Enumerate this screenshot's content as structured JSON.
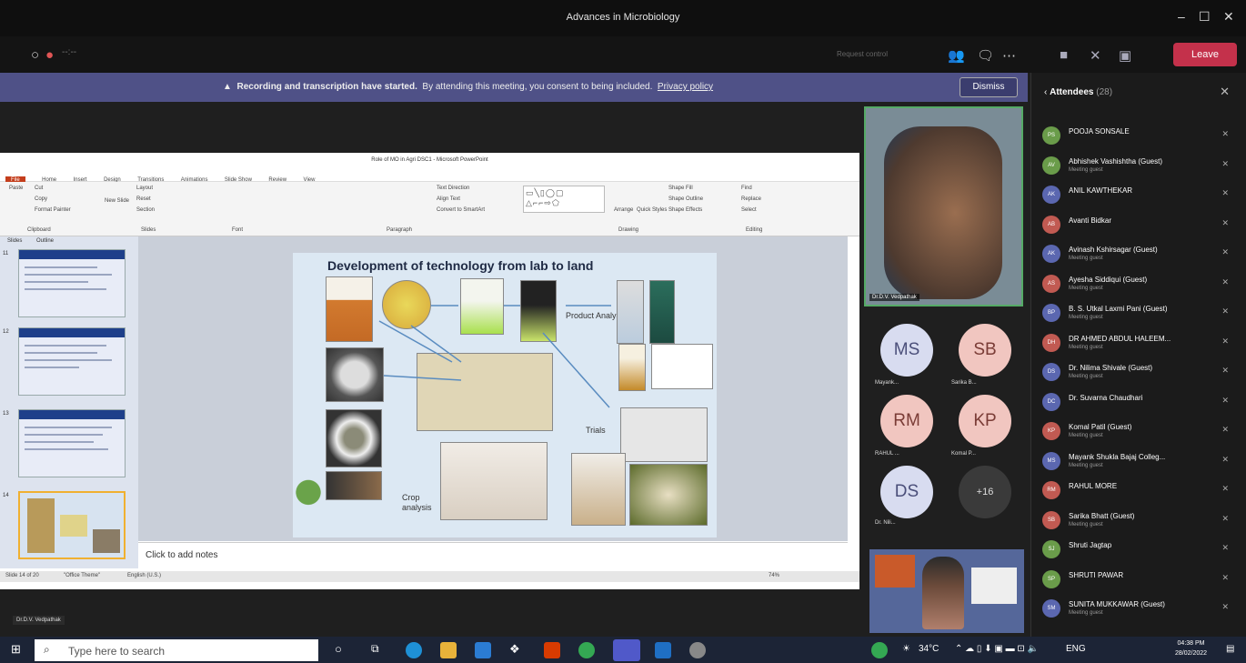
{
  "window": {
    "title": "Advances in Microbiology"
  },
  "toolbar": {
    "request_control": "Request control",
    "leave_label": "Leave"
  },
  "banner": {
    "bold": "Recording and transcription have started.",
    "text": "By attending this meeting, you consent to being included.",
    "link": "Privacy policy",
    "dismiss": "Dismiss"
  },
  "powerpoint": {
    "title": "Role of MO in Agri DSC1 - Microsoft PowerPoint",
    "tabs": [
      "File",
      "Home",
      "Insert",
      "Design",
      "Transitions",
      "Animations",
      "Slide Show",
      "Review",
      "View"
    ],
    "ribbon": {
      "cut": "Cut",
      "copy": "Copy",
      "format_painter": "Format Painter",
      "paste": "Paste",
      "new_slide": "New Slide",
      "layout": "Layout",
      "reset": "Reset",
      "section": "Section",
      "clipboard": "Clipboard",
      "slides": "Slides",
      "font": "Font",
      "paragraph": "Paragraph",
      "drawing": "Drawing",
      "editing": "Editing",
      "find": "Find",
      "replace": "Replace",
      "select": "Select",
      "text_direction": "Text Direction",
      "align_text": "Align Text",
      "smartart": "Convert to SmartArt",
      "arrange": "Arrange",
      "quick_styles": "Quick Styles",
      "shape_fill": "Shape Fill",
      "shape_outline": "Shape Outline",
      "shape_effects": "Shape Effects"
    },
    "pane_tabs": [
      "Slides",
      "Outline"
    ],
    "thumb_numbers": [
      "11",
      "12",
      "13",
      "14"
    ],
    "slide": {
      "title": "Development of technology from lab to land",
      "labels": {
        "product": "Product Analysis",
        "trials": "Trials",
        "crop": "Crop analysis"
      }
    },
    "notes_placeholder": "Click to add notes",
    "status": {
      "slide": "Slide 14 of 20",
      "theme": "\"Office Theme\"",
      "language": "English (U.S.)",
      "zoom": "74%"
    }
  },
  "presenter_label": "Dr.D.V. Vedpathak",
  "main_video": {
    "name": "Dr.D.V. Vedpathak"
  },
  "gallery": [
    {
      "initials": "MS",
      "name": "Mayank...",
      "bg": "#d8dcf0",
      "fg": "#4b4f7a"
    },
    {
      "initials": "SB",
      "name": "Sarika B...",
      "bg": "#f1c6c0",
      "fg": "#7a3c36"
    },
    {
      "initials": "RM",
      "name": "RAHUL ...",
      "bg": "#f1c6c0",
      "fg": "#7a3c36"
    },
    {
      "initials": "KP",
      "name": "Komal P...",
      "bg": "#f1c6c0",
      "fg": "#7a3c36"
    },
    {
      "initials": "DS",
      "name": "Dr. Nili...",
      "bg": "#d8dcf0",
      "fg": "#4b4f7a"
    },
    {
      "initials": "+16",
      "name": "",
      "bg": "#3a3a3a",
      "fg": "#ddd"
    }
  ],
  "attendees": {
    "title": "Attendees",
    "count": "(28)",
    "list": [
      {
        "initials": "PS",
        "name": "POOJA SONSALE",
        "sub": "",
        "color": "#6a9c4a"
      },
      {
        "initials": "AV",
        "name": "Abhishek Vashishtha (Guest)",
        "sub": "Meeting guest",
        "color": "#6a9c4a"
      },
      {
        "initials": "AK",
        "name": "ANIL KAWTHEKAR",
        "sub": "",
        "color": "#5b67b0"
      },
      {
        "initials": "AB",
        "name": "Avanti Bidkar",
        "sub": "",
        "color": "#c15a52"
      },
      {
        "initials": "AK",
        "name": "Avinash Kshirsagar (Guest)",
        "sub": "Meeting guest",
        "color": "#5b67b0"
      },
      {
        "initials": "AS",
        "name": "Ayesha Siddiqui (Guest)",
        "sub": "Meeting guest",
        "color": "#c15a52"
      },
      {
        "initials": "BP",
        "name": "B. S. Utkal Laxmi Pani (Guest)",
        "sub": "Meeting guest",
        "color": "#5b67b0"
      },
      {
        "initials": "DH",
        "name": "DR AHMED ABDUL HALEEM...",
        "sub": "Meeting guest",
        "color": "#c15a52"
      },
      {
        "initials": "DS",
        "name": "Dr. Nilima Shivale (Guest)",
        "sub": "Meeting guest",
        "color": "#5b67b0"
      },
      {
        "initials": "DC",
        "name": "Dr. Suvarna Chaudhari",
        "sub": "",
        "color": "#5b67b0"
      },
      {
        "initials": "KP",
        "name": "Komal Patil (Guest)",
        "sub": "Meeting guest",
        "color": "#c15a52"
      },
      {
        "initials": "MS",
        "name": "Mayank Shukla Bajaj Colleg...",
        "sub": "Meeting guest",
        "color": "#5b67b0"
      },
      {
        "initials": "RM",
        "name": "RAHUL MORE",
        "sub": "",
        "color": "#c15a52"
      },
      {
        "initials": "SB",
        "name": "Sarika Bhatt (Guest)",
        "sub": "Meeting guest",
        "color": "#c15a52"
      },
      {
        "initials": "SJ",
        "name": "Shruti Jagtap",
        "sub": "",
        "color": "#6a9c4a"
      },
      {
        "initials": "SP",
        "name": "SHRUTI PAWAR",
        "sub": "",
        "color": "#6a9c4a"
      },
      {
        "initials": "SM",
        "name": "SUNITA MUKKAWAR (Guest)",
        "sub": "Meeting guest",
        "color": "#5b67b0"
      }
    ]
  },
  "taskbar": {
    "search_placeholder": "Type here to search",
    "weather": "34°C",
    "language": "ENG",
    "time": "04:38 PM",
    "date": "28/02/2022"
  }
}
